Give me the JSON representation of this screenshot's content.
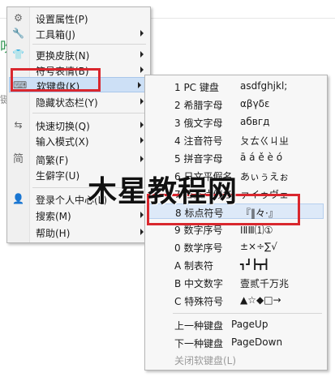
{
  "background": {
    "partial_glyph": "吹",
    "partial_text": "键"
  },
  "main_menu": {
    "items": [
      {
        "label": "设置属性(P)",
        "icon": "settings-icon",
        "glyph": "⚙",
        "submenu": false
      },
      {
        "label": "工具箱(J)",
        "icon": "wrench-icon",
        "glyph": "🔧",
        "submenu": true
      },
      {
        "label": "更换皮肤(N)",
        "icon": "shirt-icon",
        "glyph": "👕",
        "submenu": true
      },
      {
        "label": "符号表情(B)",
        "icon": "",
        "glyph": "",
        "submenu": true
      },
      {
        "label": "软键盘(K)",
        "icon": "keyboard-icon",
        "glyph": "⌨",
        "submenu": true
      },
      {
        "label": "隐藏状态栏(Y)",
        "icon": "",
        "glyph": "",
        "submenu": false
      },
      {
        "label": "快速切换(Q)",
        "icon": "switch-icon",
        "glyph": "⇆",
        "submenu": true
      },
      {
        "label": "输入模式(X)",
        "icon": "",
        "glyph": "",
        "submenu": true
      },
      {
        "label": "简繁(F)",
        "icon": "simplified-icon",
        "glyph": "简",
        "submenu": true
      },
      {
        "label": "生僻字(U)",
        "icon": "",
        "glyph": "",
        "submenu": false
      },
      {
        "label": "登录个人中心(L)",
        "icon": "user-icon",
        "glyph": "👤",
        "submenu": false
      },
      {
        "label": "搜索(M)",
        "icon": "",
        "glyph": "",
        "submenu": true
      },
      {
        "label": "帮助(H)",
        "icon": "",
        "glyph": "",
        "submenu": true
      }
    ]
  },
  "soft_keyboard_menu": {
    "items": [
      {
        "key": "1 PC 键盘",
        "value": "asdfghjkl;"
      },
      {
        "key": "2 希腊字母",
        "value": "αβγδε"
      },
      {
        "key": "3 俄文字母",
        "value": "абвгд"
      },
      {
        "key": "4 注音符号",
        "value": "ㄆㄊㄍㄐㄓ"
      },
      {
        "key": "5 拼音字母",
        "value": "ā á ě è ó"
      },
      {
        "key": "6 日文平假名",
        "value": "あぃぅえぉ"
      },
      {
        "key": "7 日文片假名",
        "value": "ァイゥヴェ"
      },
      {
        "key": "8 标点符号",
        "value": "『‖々·』"
      },
      {
        "key": "9 数字序号",
        "value": "ⅠⅡⅢ⑴①"
      },
      {
        "key": "0 数学序号",
        "value": "±×÷∑√"
      },
      {
        "key": "A 制表符",
        "value": "┓┛┣┳┫"
      },
      {
        "key": "B 中文数字",
        "value": "壹贰千万兆"
      },
      {
        "key": "C 特殊符号",
        "value": "▲☆◆□→"
      }
    ],
    "footer": [
      {
        "key": "上一种键盘",
        "value": "PageUp"
      },
      {
        "key": "下一种键盘",
        "value": "PageDown"
      },
      {
        "key": "关闭软键盘(L)",
        "value": ""
      }
    ]
  },
  "watermark": {
    "text": "木星教程网"
  },
  "colors": {
    "highlight_border": "#d9272e",
    "menu_hover": "#dbe8f8"
  }
}
